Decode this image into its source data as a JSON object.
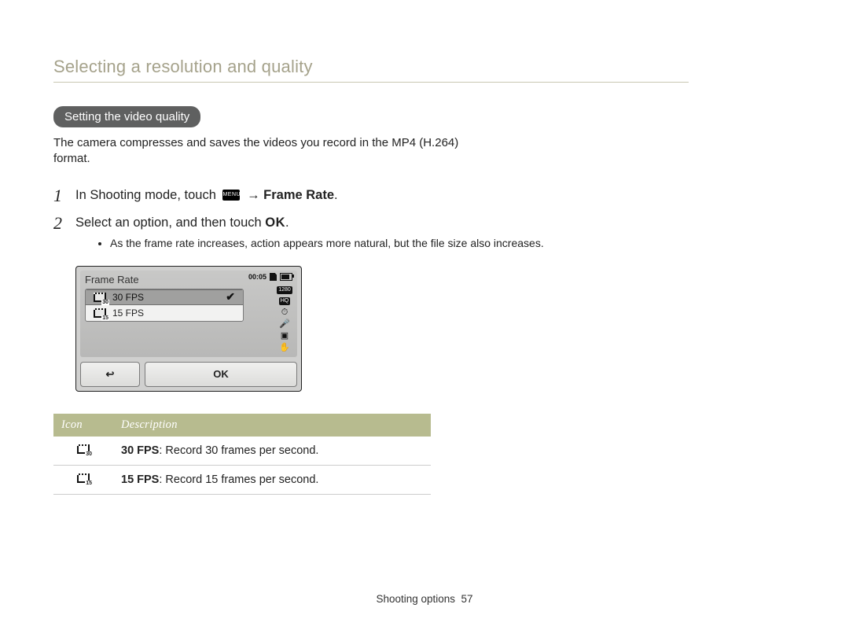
{
  "sectionTitle": "Selecting a resolution and quality",
  "pill": "Setting the video quality",
  "intro": "The camera compresses and saves the videos you record in the MP4 (H.264) format.",
  "steps": {
    "step1_prefix": "In Shooting mode, touch ",
    "menu_label": "MENU",
    "arrow": " → ",
    "step1_bold": "Frame Rate",
    "step1_suffix": ".",
    "step2_prefix": "Select an option, and then touch ",
    "step2_ok": "OK",
    "step2_suffix": "."
  },
  "note": "As the frame rate increases, action appears more natural, but the file size also increases.",
  "screen": {
    "title": "Frame Rate",
    "time": "00:05",
    "res_badge_1": "1280",
    "res_badge_2": "HQ",
    "opt30": "30 FPS",
    "opt30_sub": "30",
    "opt15": "15 FPS",
    "opt15_sub": "15",
    "check": "✔",
    "back": "↩",
    "ok": "OK"
  },
  "table": {
    "head_icon": "Icon",
    "head_desc": "Description",
    "rows": [
      {
        "sub": "30",
        "bold": "30 FPS",
        "rest": ": Record 30 frames per second."
      },
      {
        "sub": "15",
        "bold": "15 FPS",
        "rest": ": Record 15 frames per second."
      }
    ]
  },
  "footer": {
    "text": "Shooting options",
    "page": "57"
  }
}
